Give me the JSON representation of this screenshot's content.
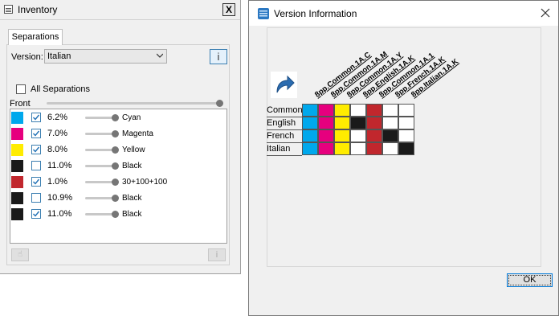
{
  "inventory": {
    "title": "Inventory",
    "close_label": "X",
    "tab_label": "Separations",
    "version_label": "Version:",
    "version_value": "Italian",
    "info_label": "i",
    "all_separations_label": "All Separations",
    "front_label": "Front",
    "hand_icon_label": "☝",
    "bottom_info_label": "i",
    "separations": [
      {
        "color": "#00a8ec",
        "checked": true,
        "percent": "6.2%",
        "name": "Cyan"
      },
      {
        "color": "#e6007e",
        "checked": true,
        "percent": "7.0%",
        "name": "Magenta"
      },
      {
        "color": "#ffec00",
        "checked": true,
        "percent": "8.0%",
        "name": "Yellow"
      },
      {
        "color": "#1a1a1a",
        "checked": false,
        "percent": "11.0%",
        "name": "Black"
      },
      {
        "color": "#c1272d",
        "checked": true,
        "percent": "1.0%",
        "name": "30+100+100"
      },
      {
        "color": "#1a1a1a",
        "checked": false,
        "percent": "10.9%",
        "name": "Black"
      },
      {
        "color": "#1a1a1a",
        "checked": true,
        "percent": "11.0%",
        "name": "Black"
      }
    ]
  },
  "version_info": {
    "title": "Version Information",
    "ok_label": "OK",
    "columns": [
      "8pp.Common.1A.C",
      "8pp.Common.1A.M",
      "8pp.Common.1A.Y",
      "8pp.English.1A.K",
      "8pp.Common.1A.1",
      "8pp.French.1A.K",
      "8pp.Italian.1A.K"
    ],
    "rows": [
      {
        "label": "Common",
        "cells": [
          "#00a8ec",
          "#e6007e",
          "#ffec00",
          "#ffffff",
          "#c1272d",
          "#ffffff",
          "#ffffff"
        ]
      },
      {
        "label": "English",
        "cells": [
          "#00a8ec",
          "#e6007e",
          "#ffec00",
          "#1a1a1a",
          "#c1272d",
          "#ffffff",
          "#ffffff"
        ]
      },
      {
        "label": "French",
        "cells": [
          "#00a8ec",
          "#e6007e",
          "#ffec00",
          "#ffffff",
          "#c1272d",
          "#1a1a1a",
          "#ffffff"
        ]
      },
      {
        "label": "Italian",
        "cells": [
          "#00a8ec",
          "#e6007e",
          "#ffec00",
          "#ffffff",
          "#c1272d",
          "#ffffff",
          "#1a1a1a"
        ]
      }
    ]
  }
}
